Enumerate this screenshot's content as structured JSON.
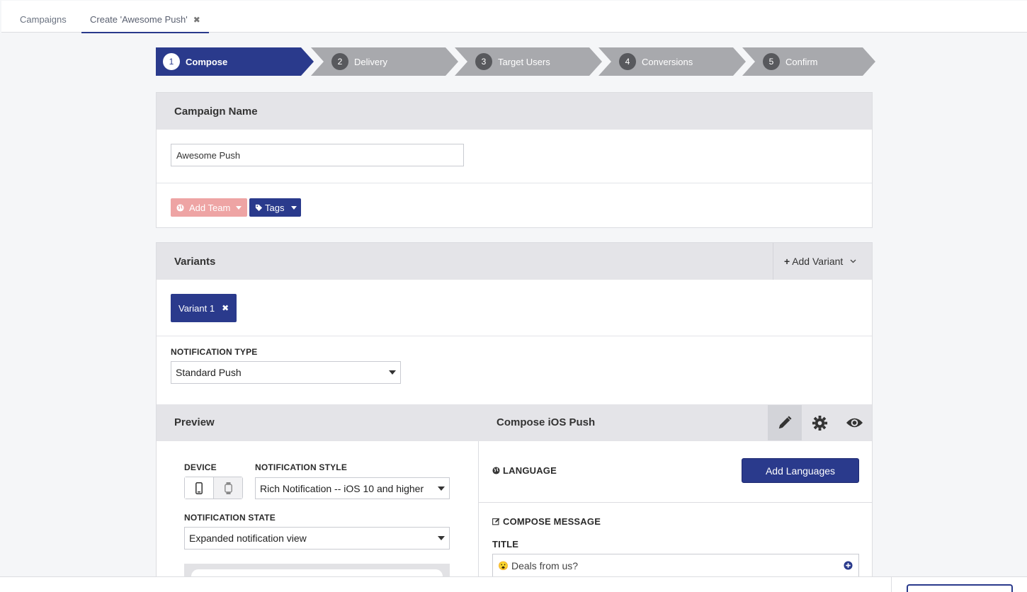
{
  "tabs": {
    "campaigns": "Campaigns",
    "create": "Create 'Awesome Push'",
    "close_glyph": "✖"
  },
  "steps": [
    {
      "num": "1",
      "label": "Compose"
    },
    {
      "num": "2",
      "label": "Delivery"
    },
    {
      "num": "3",
      "label": "Target Users"
    },
    {
      "num": "4",
      "label": "Conversions"
    },
    {
      "num": "5",
      "label": "Confirm"
    }
  ],
  "campaign": {
    "header": "Campaign Name",
    "name_value": "Awesome Push",
    "add_team_label": "Add Team",
    "tags_label": "Tags"
  },
  "variants": {
    "header": "Variants",
    "add_variant_label": "Add Variant",
    "variant_pill": "Variant 1",
    "notification_type_label": "NOTIFICATION TYPE",
    "notification_type_value": "Standard Push"
  },
  "preview": {
    "header": "Preview",
    "device_label": "DEVICE",
    "style_label": "NOTIFICATION STYLE",
    "style_value": "Rich Notification -- iOS 10 and higher",
    "state_label": "NOTIFICATION STATE",
    "state_value": "Expanded notification view"
  },
  "compose": {
    "header": "Compose iOS Push",
    "language_label": "LANGUAGE",
    "add_languages": "Add Languages",
    "compose_message_label": "COMPOSE MESSAGE",
    "title_label": "TITLE",
    "title_value": "Deals from us?",
    "title_emoji": "😮"
  },
  "colors": {
    "primary": "#2a3a8c",
    "team_button": "#eea4a4",
    "step_inactive": "#a8a9ad"
  }
}
